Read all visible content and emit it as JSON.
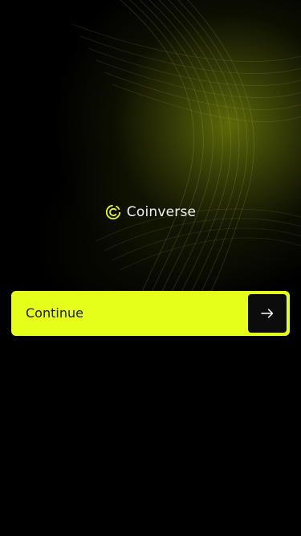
{
  "brand": {
    "name": "Coinverse",
    "logo_icon": "coinverse-logo-icon"
  },
  "continue_button": {
    "label": "Continue",
    "icon": "arrow-right-icon"
  },
  "colors": {
    "background": "#000000",
    "accent": "#e6ff1a",
    "button_icon_bg": "#0c0c0c",
    "text_light": "#f2f2f2",
    "text_dark": "#1a1a1a"
  }
}
